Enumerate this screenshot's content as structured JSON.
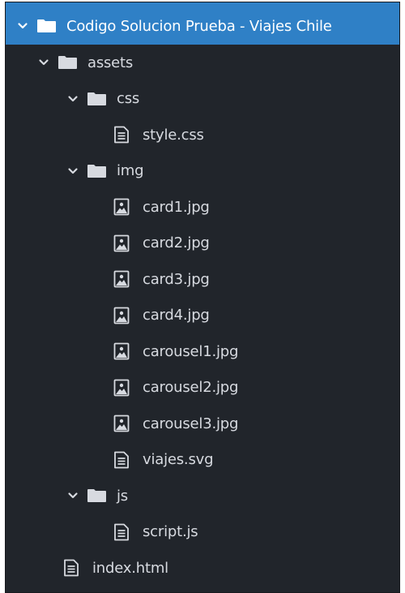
{
  "tree": {
    "root": {
      "label": "Codigo Solucion Prueba - Viajes Chile",
      "expanded": true,
      "icon": "folder-icon"
    },
    "assets": {
      "label": "assets",
      "expanded": true,
      "icon": "folder-icon"
    },
    "css": {
      "label": "css",
      "expanded": true,
      "icon": "folder-icon"
    },
    "style_css": {
      "label": "style.css",
      "icon": "text-file-icon"
    },
    "img": {
      "label": "img",
      "expanded": true,
      "icon": "folder-icon"
    },
    "img_files": [
      {
        "label": "card1.jpg",
        "icon": "image-file-icon"
      },
      {
        "label": "card2.jpg",
        "icon": "image-file-icon"
      },
      {
        "label": "card3.jpg",
        "icon": "image-file-icon"
      },
      {
        "label": "card4.jpg",
        "icon": "image-file-icon"
      },
      {
        "label": "carousel1.jpg",
        "icon": "image-file-icon"
      },
      {
        "label": "carousel2.jpg",
        "icon": "image-file-icon"
      },
      {
        "label": "carousel3.jpg",
        "icon": "image-file-icon"
      }
    ],
    "viajes_svg": {
      "label": "viajes.svg",
      "icon": "text-file-icon"
    },
    "js": {
      "label": "js",
      "expanded": true,
      "icon": "folder-icon"
    },
    "script_js": {
      "label": "script.js",
      "icon": "text-file-icon"
    },
    "index_html": {
      "label": "index.html",
      "icon": "text-file-icon"
    }
  },
  "colors": {
    "background": "#21252b",
    "selection": "#2f80c6",
    "text": "#d7dae0",
    "icon": "#d7dae0"
  }
}
